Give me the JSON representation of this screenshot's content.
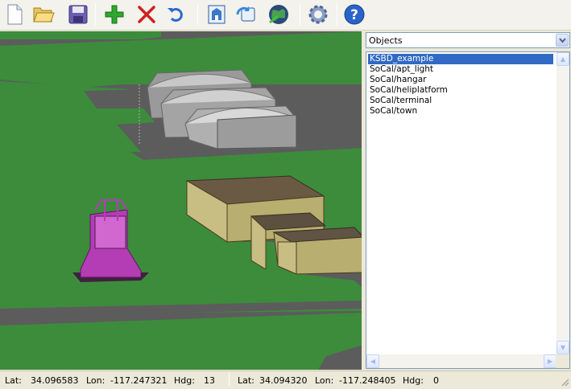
{
  "toolbar": {
    "buttons": [
      {
        "name": "new-file-icon"
      },
      {
        "name": "open-folder-icon"
      },
      {
        "name": "save-icon"
      },
      {
        "name": "add-icon"
      },
      {
        "name": "delete-icon"
      },
      {
        "name": "undo-icon"
      },
      {
        "name": "building-icon"
      },
      {
        "name": "refresh-icon"
      },
      {
        "name": "globe-icon"
      },
      {
        "name": "gear-icon"
      },
      {
        "name": "help-icon"
      }
    ]
  },
  "panel": {
    "dropdown_value": "Objects",
    "items": [
      {
        "label": "KSBD_example",
        "selected": true
      },
      {
        "label": "SoCal/apt_light",
        "selected": false
      },
      {
        "label": "SoCal/hangar",
        "selected": false
      },
      {
        "label": "SoCal/heliplatform",
        "selected": false
      },
      {
        "label": "SoCal/terminal",
        "selected": false
      },
      {
        "label": "SoCal/town",
        "selected": false
      }
    ]
  },
  "status": {
    "left": {
      "lat_label": "Lat:",
      "lat": "34.096583",
      "lon_label": "Lon:",
      "lon": "-117.247321",
      "hdg_label": "Hdg:",
      "hdg": "13"
    },
    "right": {
      "lat_label": "Lat:",
      "lat": "34.094320",
      "lon_label": "Lon:",
      "lon": "-117.248405",
      "hdg_label": "Hdg:",
      "hdg": "0"
    }
  },
  "colors": {
    "grass": "#3c8c3c",
    "runway": "#5c5c5c",
    "selection": "#316ac5"
  }
}
